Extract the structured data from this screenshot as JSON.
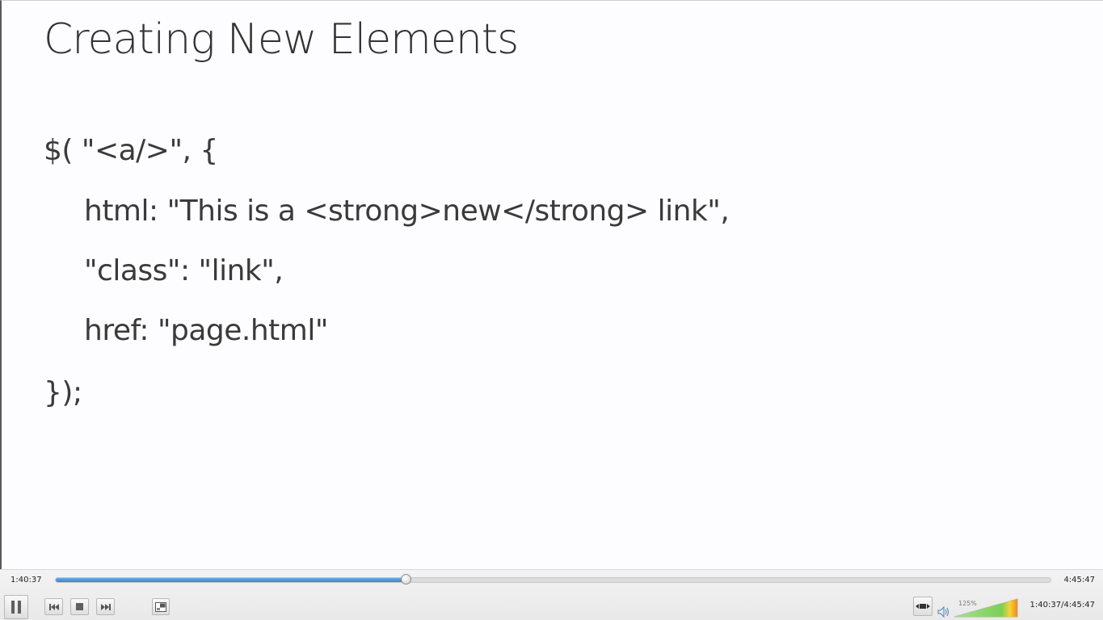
{
  "slide": {
    "title": "Creating New Elements",
    "code_lines": [
      "$( \"<a/>\", {",
      "html: \"This is a <strong>new</strong> link\",",
      "\"class\": \"link\",",
      "href: \"page.html\"",
      "});"
    ]
  },
  "player": {
    "elapsed": "1:40:37",
    "total": "4:45:47",
    "elapsed_total": "1:40:37/4:45:47",
    "progress_fraction": 0.3514,
    "volume_label": "125%",
    "volume_fraction": 1.0,
    "icons": {
      "pause": "pause-icon",
      "previous": "skip-previous-icon",
      "stop": "stop-icon",
      "next": "skip-next-icon",
      "fullscreen": "fullscreen-icon",
      "stretch": "stretch-icon",
      "speaker": "speaker-icon"
    },
    "colors": {
      "progress": "#3e85cf",
      "volume_start": "#8fd37a",
      "volume_end": "#f08a1c"
    }
  }
}
